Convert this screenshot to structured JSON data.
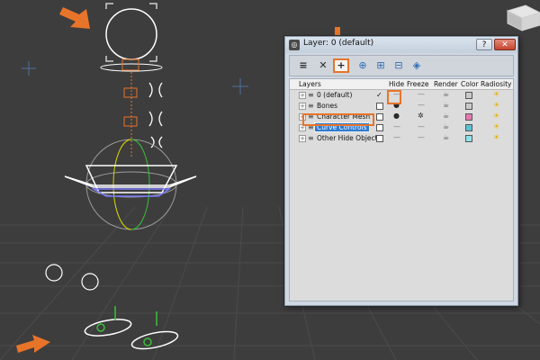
{
  "window": {
    "title": "Layer: 0 (default)",
    "help_label": "?",
    "close_label": "✕"
  },
  "toolbar": {
    "tools": [
      "create-new-layer-from-selection",
      "delete-layer",
      "add-selection-to-layer",
      "select-objects-in-layer",
      "highlight-selected-objects-layers",
      "hide-unhide-all",
      "freeze-unfreeze-all"
    ],
    "new_layer_label": "+",
    "delete_label": "✕"
  },
  "columns": {
    "layers": "Layers",
    "hide": "Hide",
    "freeze": "Freeze",
    "render": "Render",
    "color": "Color",
    "radiosity": "Radiosity"
  },
  "layers": [
    {
      "name": "0 (default)",
      "current": true,
      "color": "#c9c9c9"
    },
    {
      "name": "Bones",
      "current": false,
      "color": "#c9c9c9"
    },
    {
      "name": "Character Mesh",
      "current": false,
      "color": "#e879b0"
    },
    {
      "name": "Curve Controls",
      "current": false,
      "color": "#5bc2d6",
      "selected": true
    },
    {
      "name": "Other Hide Objects",
      "current": false,
      "color": "#8fe0ea"
    }
  ],
  "colors": {
    "viewport_bg": "#3d3d3d",
    "grid": "#4a4a4a",
    "accent_arrow": "#e8742a",
    "selection": "#2d7bd3",
    "window_bg": "#cfd8e3"
  }
}
